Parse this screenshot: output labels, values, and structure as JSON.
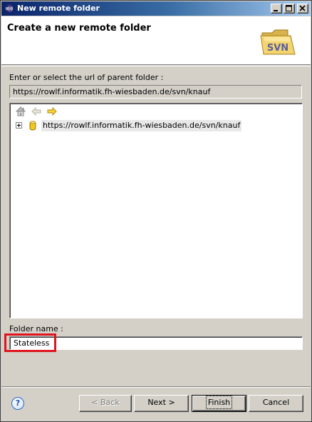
{
  "window": {
    "title": "New remote folder"
  },
  "banner": {
    "title": "Create a new remote folder",
    "icon": "svn-folder-icon",
    "icon_text": "SVN"
  },
  "parent": {
    "label": "Enter or select the url of parent folder :",
    "url_value": "https://rowlf.informatik.fh-wiesbaden.de/svn/knauf"
  },
  "tree": {
    "toolbar": [
      "home-icon",
      "back-arrow-icon",
      "forward-arrow-icon"
    ],
    "items": [
      {
        "label": "https://rowlf.informatik.fh-wiesbaden.de/svn/knauf",
        "icon": "repository-icon",
        "expanded": false
      }
    ]
  },
  "folder": {
    "label": "Folder name :",
    "value": "Stateless"
  },
  "buttons": {
    "help": "?",
    "back": "< Back",
    "next": "Next >",
    "finish": "Finish",
    "cancel": "Cancel"
  },
  "colors": {
    "titlebar_start": "#0a246a",
    "titlebar_end": "#a6caf0",
    "highlight": "#e0141e"
  }
}
